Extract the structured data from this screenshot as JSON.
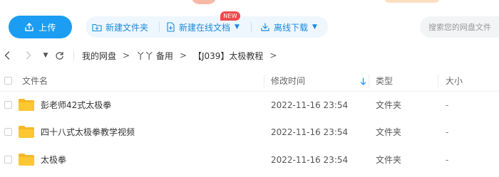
{
  "toolbar": {
    "upload_label": "上传",
    "new_folder_label": "新建文件夹",
    "new_online_doc_label": "新建在线文档",
    "new_badge": "NEW",
    "offline_download_label": "离线下载",
    "accent_color": "#1a9df2"
  },
  "search": {
    "placeholder": "搜索您的网盘文件"
  },
  "breadcrumb": {
    "items": [
      "我的网盘",
      "丫丫 备用",
      "【J039】太极教程"
    ]
  },
  "table": {
    "headers": {
      "name": "文件名",
      "modified": "修改时间",
      "type": "类型",
      "size": "大小"
    },
    "sort_icon": "sort-down-arrow-icon",
    "rows": [
      {
        "name": "彭老师42式太极拳",
        "modified": "2022-11-16 23:54",
        "type": "文件夹",
        "size": "-"
      },
      {
        "name": "四十八式太极拳教学视频",
        "modified": "2022-11-16 23:54",
        "type": "文件夹",
        "size": "-"
      },
      {
        "name": "太极拳",
        "modified": "2022-11-16 23:54",
        "type": "文件夹",
        "size": "-"
      }
    ]
  }
}
